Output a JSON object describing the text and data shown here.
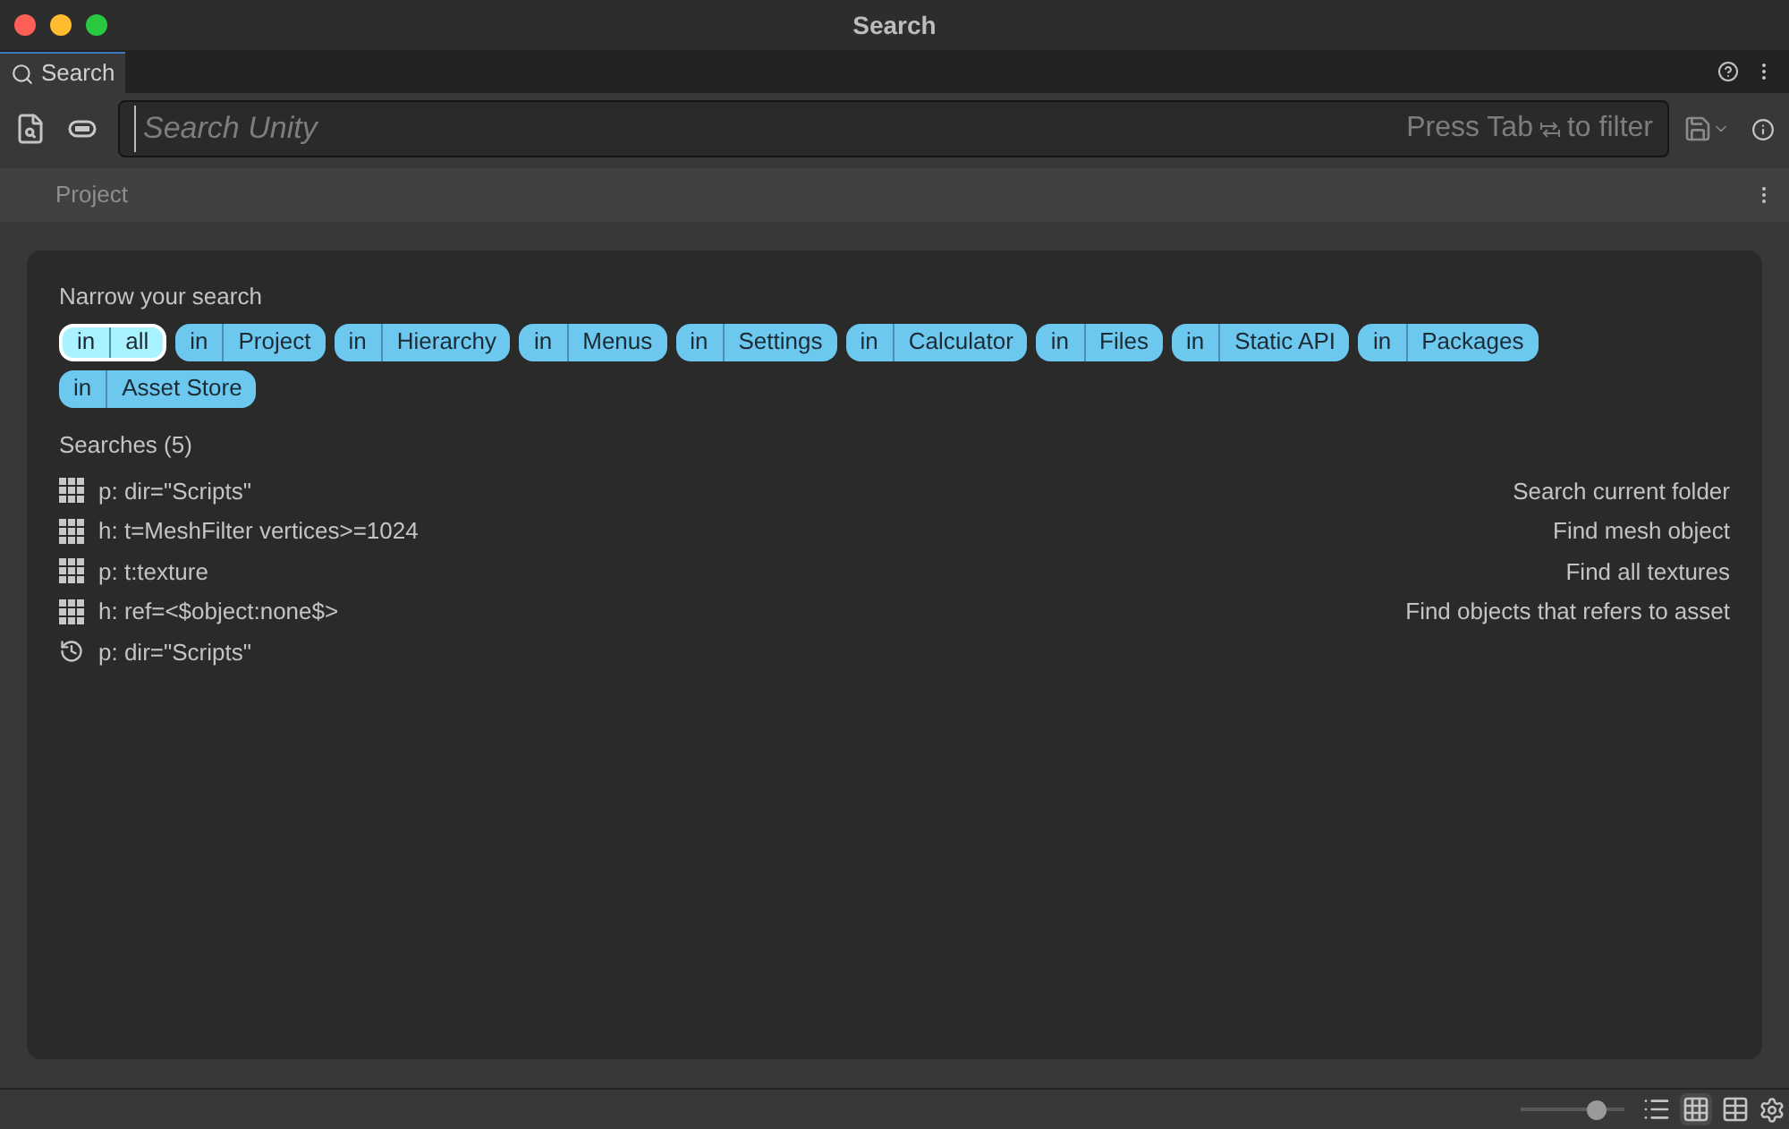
{
  "window": {
    "title": "Search"
  },
  "tab": {
    "label": "Search"
  },
  "search": {
    "placeholder": "Search Unity",
    "hint_before": "Press Tab",
    "hint_after": "to filter"
  },
  "scope": {
    "label": "Project"
  },
  "narrow": {
    "title": "Narrow your search",
    "filters": [
      {
        "prefix": "in",
        "label": "all",
        "selected": true
      },
      {
        "prefix": "in",
        "label": "Project",
        "selected": false
      },
      {
        "prefix": "in",
        "label": "Hierarchy",
        "selected": false
      },
      {
        "prefix": "in",
        "label": "Menus",
        "selected": false
      },
      {
        "prefix": "in",
        "label": "Settings",
        "selected": false
      },
      {
        "prefix": "in",
        "label": "Calculator",
        "selected": false
      },
      {
        "prefix": "in",
        "label": "Files",
        "selected": false
      },
      {
        "prefix": "in",
        "label": "Static API",
        "selected": false
      },
      {
        "prefix": "in",
        "label": "Packages",
        "selected": false
      },
      {
        "prefix": "in",
        "label": "Asset Store",
        "selected": false
      }
    ]
  },
  "searches": {
    "title": "Searches (5)",
    "items": [
      {
        "kind": "saved",
        "query": "p: dir=\"Scripts\"",
        "description": "Search current folder"
      },
      {
        "kind": "saved",
        "query": "h: t=MeshFilter vertices>=1024",
        "description": "Find mesh object"
      },
      {
        "kind": "saved",
        "query": "p: t:texture",
        "description": "Find all textures"
      },
      {
        "kind": "saved",
        "query": "h: ref=<$object:none$>",
        "description": "Find objects that refers to asset"
      },
      {
        "kind": "recent",
        "query": "p: dir=\"Scripts\""
      }
    ]
  },
  "status_bar": {
    "zoom": {
      "level": 0.72
    },
    "views": [
      {
        "kind": "list",
        "selected": false
      },
      {
        "kind": "grid",
        "selected": true
      },
      {
        "kind": "table",
        "selected": false
      }
    ]
  }
}
